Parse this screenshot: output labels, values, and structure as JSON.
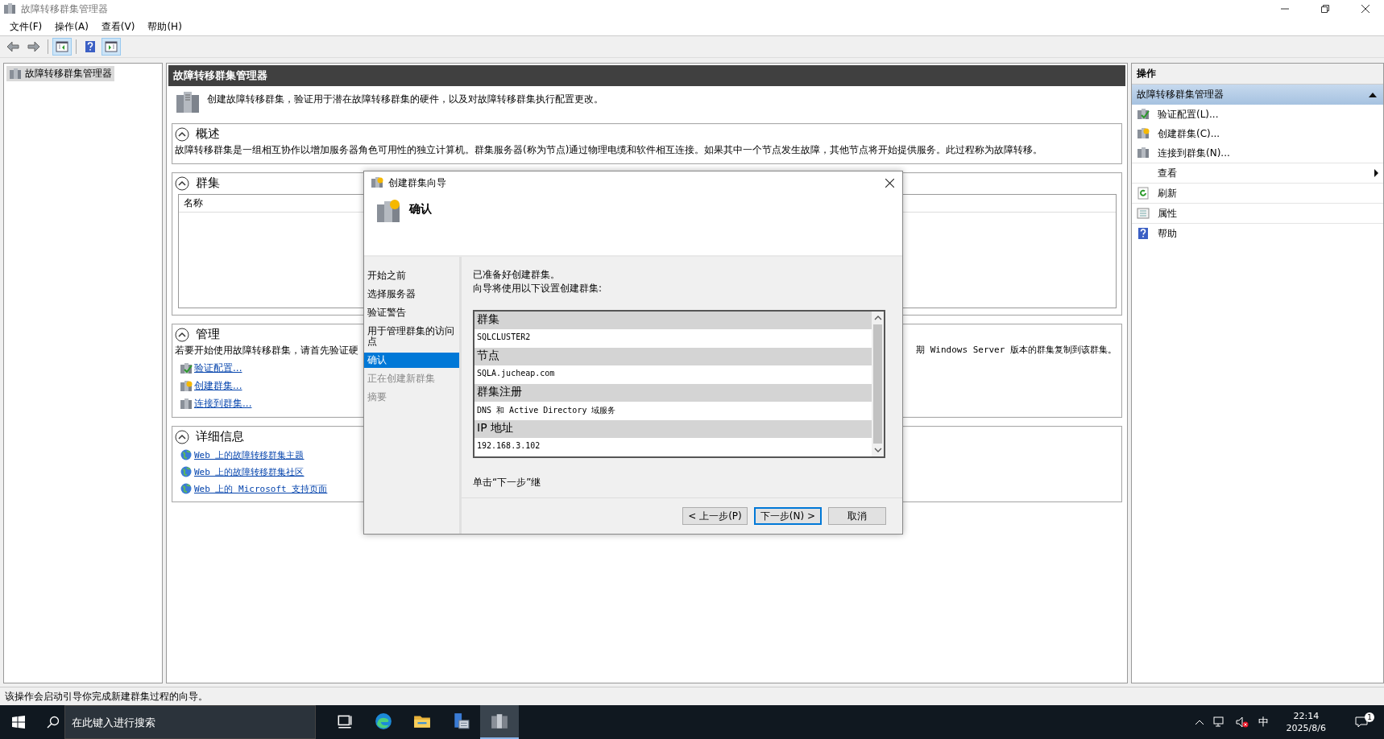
{
  "window": {
    "title": "故障转移群集管理器"
  },
  "menu": [
    "文件(F)",
    "操作(A)",
    "查看(V)",
    "帮助(H)"
  ],
  "toolbar": [
    {
      "kind": "back",
      "pressed": false
    },
    {
      "kind": "forward",
      "pressed": false
    },
    {
      "kind": "tree",
      "pressed": true
    },
    {
      "kind": "help",
      "pressed": false
    },
    {
      "kind": "actions",
      "pressed": true
    }
  ],
  "tree": {
    "items": [
      {
        "label": "故障转移群集管理器",
        "selected": true
      }
    ]
  },
  "center": {
    "header": "故障转移群集管理器",
    "description": "创建故障转移群集，验证用于潜在故障转移群集的硬件，以及对故障转移群集执行配置更改。",
    "overview": {
      "title": "概述",
      "expanded": true,
      "text": "故障转移群集是一组相互协作以增加服务器角色可用性的独立计算机。群集服务器(称为节点)通过物理电缆和软件相互连接。如果其中一个节点发生故障，其他节点将开始提供服务。此过程称为故障转移。"
    },
    "clusters": {
      "title": "群集",
      "expanded": true,
      "columns": [
        "名称"
      ]
    },
    "management": {
      "title": "管理",
      "expanded": true,
      "text_start": "若要开始使用故障转移群集，请首先验证硬",
      "text_end": "期 Windows Server 版本的群集复制到该群集。",
      "links": [
        "验证配置...",
        "创建群集...",
        "连接到群集..."
      ]
    },
    "details": {
      "title": "详细信息",
      "expanded": true,
      "links": [
        "Web 上的故障转移群集主题",
        "Web 上的故障转移群集社区",
        "Web 上的 Microsoft 支持页面"
      ]
    }
  },
  "actions": {
    "title": "操作",
    "group": {
      "label": "故障转移群集管理器",
      "expanded": true
    },
    "items": [
      {
        "label": "验证配置(L)...",
        "submenu": false
      },
      {
        "label": "创建群集(C)...",
        "submenu": false
      },
      {
        "label": "连接到群集(N)...",
        "submenu": false
      },
      {
        "label": "查看",
        "submenu": true
      },
      {
        "label": "刷新",
        "submenu": false
      },
      {
        "label": "属性",
        "submenu": false
      },
      {
        "label": "帮助",
        "submenu": false
      }
    ]
  },
  "dialog": {
    "title": "创建群集向导",
    "heading": "确认",
    "steps": [
      {
        "label": "开始之前",
        "selected": false,
        "disabled": false
      },
      {
        "label": "选择服务器",
        "selected": false,
        "disabled": false
      },
      {
        "label": "验证警告",
        "selected": false,
        "disabled": false
      },
      {
        "label": "用于管理群集的访问点",
        "selected": false,
        "disabled": false
      },
      {
        "label": "确认",
        "selected": true,
        "disabled": false
      },
      {
        "label": "正在创建新群集",
        "selected": false,
        "disabled": true
      },
      {
        "label": "摘要",
        "selected": false,
        "disabled": true
      }
    ],
    "intro": "已准备好创建群集。",
    "intro2": "向导将使用以下设置创建群集:",
    "settings": [
      {
        "label": "群集",
        "value": "SQLCLUSTER2"
      },
      {
        "label": "节点",
        "value": "SQLA.jucheap.com"
      },
      {
        "label": "群集注册",
        "value": "DNS 和 Active Directory 域服务"
      },
      {
        "label": "IP 地址",
        "value": "192.168.3.102"
      }
    ],
    "hint": "单击“下一步”继",
    "buttons": [
      {
        "label": "< 上一步(P)",
        "default": false
      },
      {
        "label": "下一步(N) >",
        "default": true
      },
      {
        "label": "取消",
        "default": false
      }
    ]
  },
  "status_bar": "该操作会启动引导你完成新建群集过程的向导。",
  "taskbar": {
    "search_placeholder": "在此键入进行搜索",
    "apps": [
      {
        "kind": "task-view",
        "selected": false
      },
      {
        "kind": "edge",
        "selected": false
      },
      {
        "kind": "explorer",
        "selected": false
      },
      {
        "kind": "server-manager",
        "selected": false
      },
      {
        "kind": "cluster-manager",
        "selected": true
      }
    ],
    "ime": "中",
    "time": "22:14",
    "date": "2025/8/6",
    "notifications": "1"
  }
}
